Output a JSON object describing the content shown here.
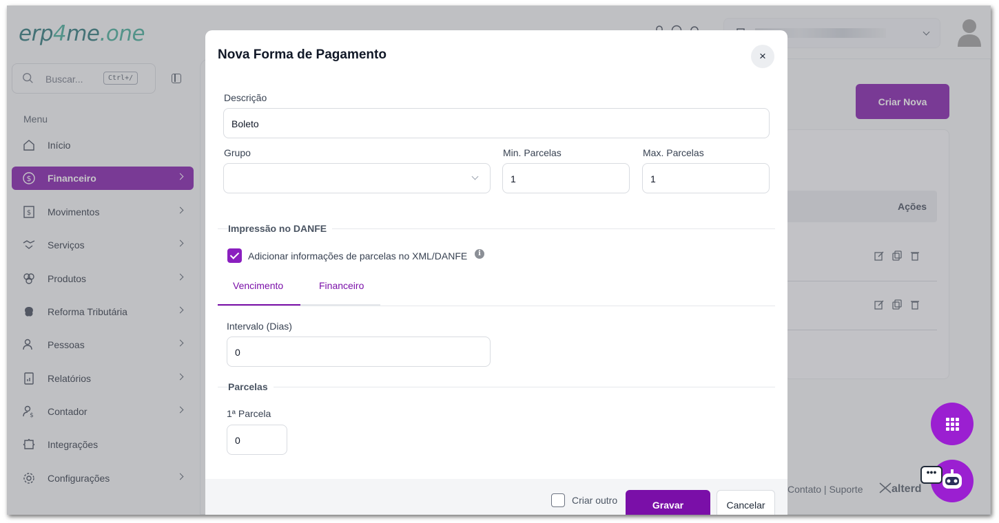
{
  "app": {
    "logo_main": "erp",
    "logo_num": "4",
    "logo_rest": "me",
    "logo_tld": ".one"
  },
  "sidebar": {
    "search_placeholder": "Buscar...",
    "search_shortcut": "Ctrl+/",
    "menu_title": "Menu",
    "items": [
      {
        "label": "Início",
        "icon": "home-icon",
        "has_chevron": false,
        "active": false
      },
      {
        "label": "Financeiro",
        "icon": "dollar-circle-icon",
        "has_chevron": true,
        "active": true
      },
      {
        "label": "Movimentos",
        "icon": "receipt-icon",
        "has_chevron": true,
        "active": false
      },
      {
        "label": "Serviços",
        "icon": "handshake-icon",
        "has_chevron": true,
        "active": false
      },
      {
        "label": "Produtos",
        "icon": "boxes-icon",
        "has_chevron": true,
        "active": false
      },
      {
        "label": "Reforma Tributária",
        "icon": "brain-icon",
        "has_chevron": true,
        "active": false
      },
      {
        "label": "Pessoas",
        "icon": "users-icon",
        "has_chevron": true,
        "active": false
      },
      {
        "label": "Relatórios",
        "icon": "report-icon",
        "has_chevron": true,
        "active": false
      },
      {
        "label": "Contador",
        "icon": "accountant-icon",
        "has_chevron": true,
        "active": false
      },
      {
        "label": "Integrações",
        "icon": "puzzle-icon",
        "has_chevron": false,
        "active": false
      },
      {
        "label": "Configurações",
        "icon": "gear-icon",
        "has_chevron": true,
        "active": false
      }
    ]
  },
  "background": {
    "create_button": "Criar Nova",
    "actions_header": "Ações",
    "footer_links": "Contato | Suporte",
    "footer_brand": "alterd"
  },
  "modal": {
    "title": "Nova Forma de Pagamento",
    "close_label": "×",
    "descricao_label": "Descrição",
    "descricao_value": "Boleto",
    "grupo_label": "Grupo",
    "grupo_value": "",
    "min_parcelas_label": "Min. Parcelas",
    "min_parcelas_value": "1",
    "max_parcelas_label": "Max. Parcelas",
    "max_parcelas_value": "1",
    "section_danfe": "Impressão no DANFE",
    "danfe_checkbox_label": "Adicionar informações de parcelas no XML/DANFE",
    "danfe_checked": true,
    "info_glyph": "i",
    "tabs": [
      {
        "label": "Vencimento",
        "active": true
      },
      {
        "label": "Financeiro",
        "active": false
      }
    ],
    "intervalo_label": "Intervalo (Dias)",
    "intervalo_value": "0",
    "section_parcelas": "Parcelas",
    "primeira_parcela_label": "1ª Parcela",
    "primeira_parcela_value": "0",
    "footer": {
      "criar_outro_label": "Criar outro",
      "criar_outro_checked": false,
      "save_label": "Gravar",
      "cancel_label": "Cancelar"
    }
  },
  "colors": {
    "brand_purple": "#7a0fa8",
    "fab_purple": "#9b1fd1",
    "logo_teal": "#1f6f73",
    "logo_green": "#3aa893"
  }
}
